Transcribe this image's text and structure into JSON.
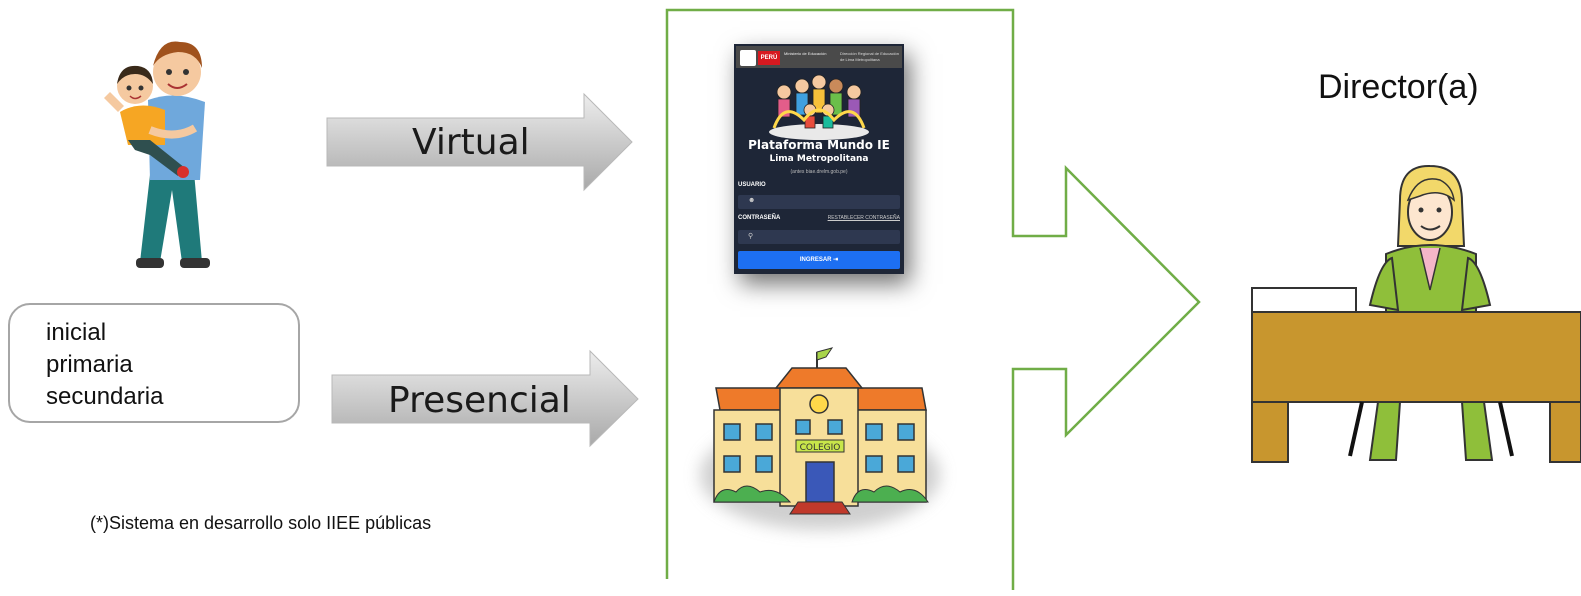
{
  "arrows": {
    "virtual_label": "Virtual",
    "presencial_label": "Presencial"
  },
  "levels": [
    "inicial",
    "primaria",
    "secundaria"
  ],
  "footnote": "(*)Sistema en desarrollo solo IIEE públicas",
  "director": {
    "title": "Director(a)"
  },
  "platform": {
    "topbar": {
      "peru": "PERÚ",
      "ministry": "Ministerio de Educación",
      "dre": "Dirección Regional de Educación de Lima Metropolitana"
    },
    "title": "Plataforma Mundo IE",
    "subtitle": "Lima Metropolitana",
    "formerly": "(antes biae.drelm.gob.pe)",
    "user_label": "USUARIO",
    "password_label": "CONTRASEÑA",
    "reset_link": "RESTABLECER CONTRASEÑA",
    "login_button": "INGRESAR ⇥"
  },
  "school": {
    "sign": "COLEGIO"
  },
  "colors": {
    "arrow_fill_top": "#e6e6e6",
    "arrow_fill_bottom": "#a6a6a6",
    "green_outline": "#70ad47",
    "phone_bg": "#1e2637",
    "login_blue": "#1d6ff2"
  }
}
